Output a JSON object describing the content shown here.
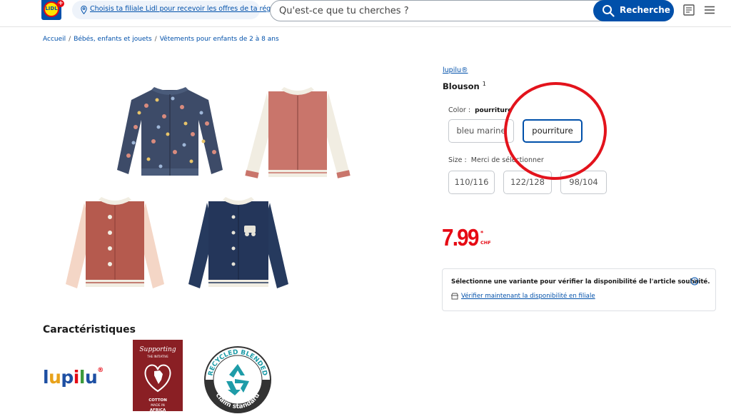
{
  "header": {
    "logo_text": "LIDL",
    "store_prompt": "Choisis ta filiale Lidl pour recevoir les offres de ta région",
    "search_placeholder": "Qu'est-ce que tu cherches ?",
    "search_button": "Recherche"
  },
  "breadcrumb": [
    "Accueil",
    "Bébés, enfants et jouets",
    "Vêtements pour enfants de 2 à 8 ans"
  ],
  "product": {
    "brand": "lupilu®",
    "title": "Blouson",
    "title_sup": "1",
    "color_label": "Color :",
    "color_value": "pourriture",
    "colors": [
      "bleu marine",
      "pourriture"
    ],
    "size_label": "Size :",
    "size_value": "Merci de sélectionner",
    "sizes": [
      "110/116",
      "122/128",
      "98/104"
    ],
    "price": "7.99",
    "price_star": "*",
    "currency": "CHF"
  },
  "availability": {
    "message": "Sélectionne une variante pour vérifier la disponibilité de l'article souhaité.",
    "link": "Vérifier maintenant la disponibilité en filiale"
  },
  "features": {
    "title": "Caractéristiques",
    "lupilu_logo": "lupilu",
    "lupilu_reg": "®",
    "cotton_badge_text": [
      "Supporting",
      "THE INITIATIVE",
      "COTTON",
      "MADE IN",
      "AFRICA"
    ],
    "recycled_badge_top": "RECYCLED BLENDED",
    "recycled_badge_bottom": "claim standard"
  },
  "colors": {
    "lidl_blue": "#0050aa",
    "lidl_red": "#e60a14",
    "lidl_yellow": "#ffe500",
    "annotation_red": "#e3131c"
  }
}
